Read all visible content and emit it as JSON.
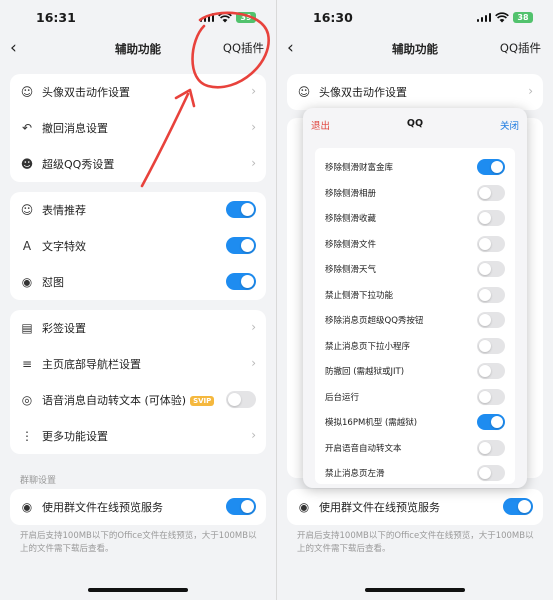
{
  "left": {
    "status": {
      "time": "16:31",
      "battery": "39"
    },
    "nav": {
      "title": "辅助功能",
      "right": "QQ插件"
    },
    "group1": [
      {
        "icon": "avatar-icon",
        "label": "头像双击动作设置"
      },
      {
        "icon": "undo-icon",
        "label": "撤回消息设置"
      },
      {
        "icon": "show-icon",
        "label": "超级QQ秀设置"
      }
    ],
    "group2": [
      {
        "icon": "smile-icon",
        "label": "表情推荐",
        "on": true
      },
      {
        "icon": "text-effect-icon",
        "label": "文字特效",
        "on": true
      },
      {
        "icon": "meme-icon",
        "label": "怼图",
        "on": true
      }
    ],
    "group3": [
      {
        "icon": "sign-icon",
        "label": "彩签设置"
      },
      {
        "icon": "menu-icon",
        "label": "主页底部导航栏设置"
      },
      {
        "icon": "voice-icon",
        "label": "语音消息自动转文本 (可体验)",
        "badge": "SVIP",
        "toggle": true,
        "on": false
      },
      {
        "icon": "grid-icon",
        "label": "更多功能设置"
      }
    ],
    "group_settings_label": "群聊设置",
    "group4": [
      {
        "icon": "eye-icon",
        "label": "使用群文件在线预览服务",
        "on": true
      }
    ],
    "footnote": "开启后支持100MB以下的Office文件在线预览，大于100MB以上的文件需下载后查看。"
  },
  "right": {
    "status": {
      "time": "16:30",
      "battery": "38"
    },
    "nav": {
      "title": "辅助功能",
      "right": "QQ插件"
    },
    "modal": {
      "exit": "退出",
      "title": "QQ",
      "close": "关闭",
      "items": [
        {
          "label": "移除侧滑财富金库",
          "on": true
        },
        {
          "label": "移除侧滑相册",
          "on": false
        },
        {
          "label": "移除侧滑收藏",
          "on": false
        },
        {
          "label": "移除侧滑文件",
          "on": false
        },
        {
          "label": "移除侧滑天气",
          "on": false
        },
        {
          "label": "禁止侧滑下拉功能",
          "on": false
        },
        {
          "label": "移除消息页超级QQ秀按钮",
          "on": false
        },
        {
          "label": "禁止消息页下拉小程序",
          "on": false
        },
        {
          "label": "防撤回 (需越狱或JIT)",
          "on": false
        },
        {
          "label": "后台运行",
          "on": false
        },
        {
          "label": "模拟16PM机型 (需越狱)",
          "on": true
        },
        {
          "label": "开启语音自动转文本",
          "on": false
        },
        {
          "label": "禁止消息页左滑",
          "on": false
        }
      ]
    },
    "bg_rows": [
      "头像双击动作设置",
      "使用群文件在线预览服务"
    ],
    "footnote": "开启后支持100MB以下的Office文件在线预览，大于100MB以上的文件需下载后查看。"
  },
  "colors": {
    "accent": "#1e8cf0",
    "annotation": "#e8423c",
    "danger": "#e0443d"
  }
}
